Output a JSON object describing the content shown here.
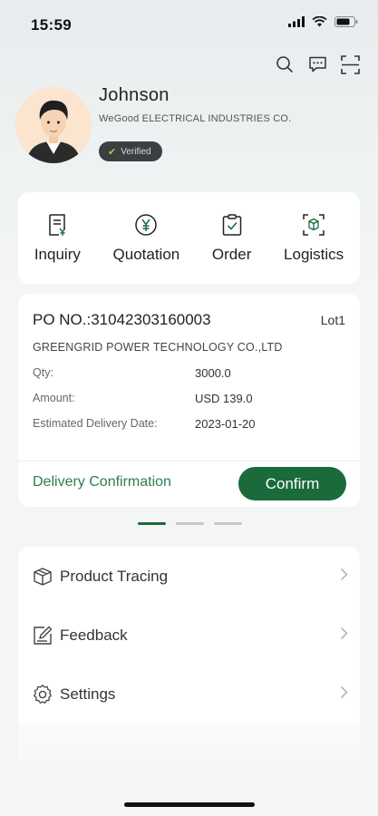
{
  "status_bar": {
    "time": "15:59"
  },
  "profile": {
    "name": "Johnson",
    "company": "WeGood ELECTRICAL INDUSTRIES CO.",
    "verified_label": "Verified"
  },
  "quick_actions": [
    {
      "label": "Inquiry",
      "icon": "inquiry-document-icon"
    },
    {
      "label": "Quotation",
      "icon": "yen-coin-icon"
    },
    {
      "label": "Order",
      "icon": "clipboard-check-icon"
    },
    {
      "label": "Logistics",
      "icon": "logistics-box-icon"
    }
  ],
  "po_card": {
    "po_label": "PO NO.:31042303160003",
    "lot": "Lot1",
    "supplier": "GREENGRID POWER TECHNOLOGY CO.,LTD",
    "rows": [
      {
        "label": "Qty:",
        "value": "3000.0"
      },
      {
        "label": "Amount:",
        "value": "USD 139.0"
      },
      {
        "label": "Estimated Delivery Date:",
        "value": "2023-01-20"
      }
    ],
    "status_text": "Delivery Confirmation",
    "confirm_label": "Confirm"
  },
  "pager": {
    "count": 3,
    "active_index": 0
  },
  "menu": [
    {
      "label": "Product Tracing",
      "icon": "box-icon"
    },
    {
      "label": "Feedback",
      "icon": "edit-icon"
    },
    {
      "label": "Settings",
      "icon": "gear-icon"
    }
  ],
  "colors": {
    "accent": "#1a6a3c",
    "verified_bg": "#3b3f42"
  }
}
